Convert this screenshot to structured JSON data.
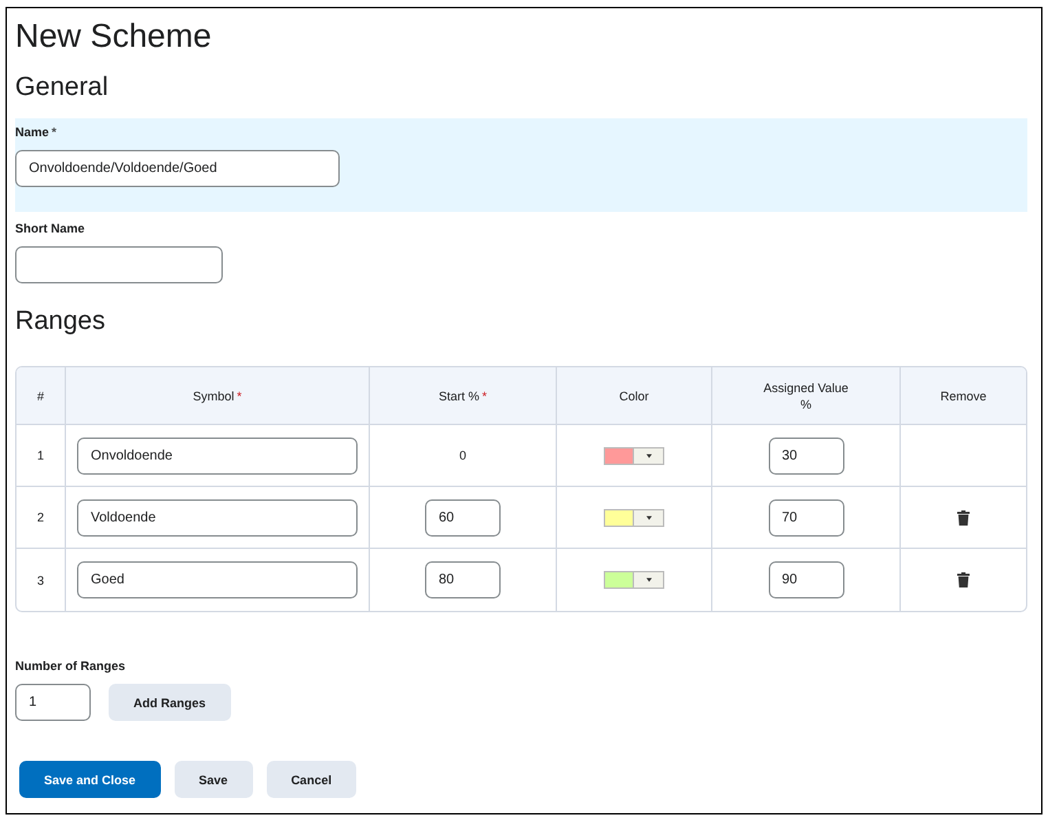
{
  "title": "New Scheme",
  "general": {
    "heading": "General",
    "name": {
      "label": "Name",
      "mark": "*",
      "value": "Onvoldoende/Voldoende/Goed"
    },
    "short_name": {
      "label": "Short Name"
    }
  },
  "ranges": {
    "heading": "Ranges",
    "columns": [
      {
        "label": "#"
      },
      {
        "label": "Symbol",
        "mark": "*"
      },
      {
        "label": "Start %",
        "mark": "*"
      },
      {
        "label": "Color"
      },
      {
        "label": "Assigned Value %"
      },
      {
        "label": "Remove"
      }
    ],
    "rows": [
      {
        "index": "1",
        "symbol": "Onvoldoende",
        "start": {
          "kind": "text",
          "value": "0"
        },
        "color": "#ff9999",
        "assigned": "30",
        "removable": false
      },
      {
        "index": "2",
        "symbol": "Voldoende",
        "start": {
          "kind": "field",
          "value": "60"
        },
        "color": "#ffff99",
        "assigned": "70",
        "removable": true
      },
      {
        "index": "3",
        "symbol": "Goed",
        "start": {
          "kind": "field",
          "value": "80"
        },
        "color": "#ccff99",
        "assigned": "90",
        "removable": true
      }
    ]
  },
  "number_of_ranges": {
    "label": "Number of Ranges",
    "value": "1",
    "button": "Add Ranges"
  },
  "buttons": [
    {
      "label": "Save and Close",
      "primary": true
    },
    {
      "label": "Save",
      "primary": false
    },
    {
      "label": "Cancel",
      "primary": false
    }
  ]
}
